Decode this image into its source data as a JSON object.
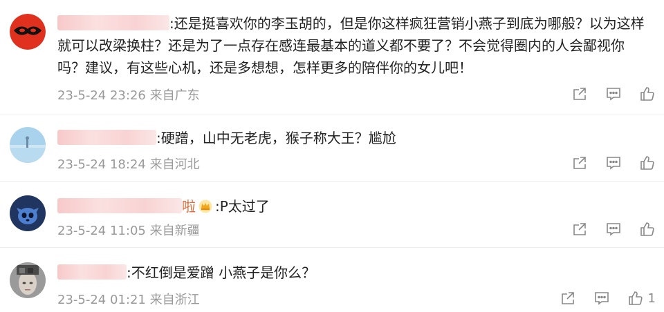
{
  "comments": [
    {
      "name_tail": "",
      "text_l1": ":还是挺喜欢你的李玉胡的，但是你这样疯狂营销小燕子到底为哪般？以为这样",
      "text_l2": "就可以改梁换柱？还是为了一点存在感连最基本的道义都不要了？不会觉得圈内的人会鄙视你",
      "text_l3": "吗？建议，有这些心机，还是多想想，怎样更多的陪伴你的女儿吧！",
      "meta": "23-5-24 23:26 来自广东"
    },
    {
      "name_tail": "",
      "text_l1": ":硬蹭，山中无老虎，猴子称大王？尴尬",
      "meta": "23-5-24 18:24 来自河北"
    },
    {
      "name_tail": "啦",
      "text_l1": ":P太过了",
      "meta": "23-5-24 11:05 来自新疆"
    },
    {
      "name_tail": "",
      "text_l1": ":不红倒是爱蹭 小燕子是你么？",
      "meta": "23-5-24 01:21 来自浙江",
      "like_count": "1"
    }
  ],
  "icons": {
    "share": "share-icon",
    "comment": "comment-icon",
    "like": "like-icon"
  }
}
